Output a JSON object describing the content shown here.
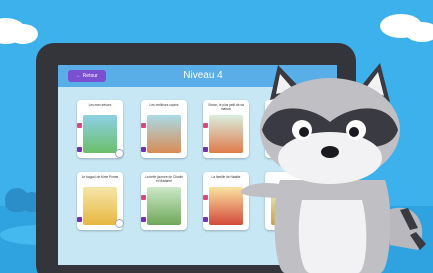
{
  "header": {
    "back_label": "← Retour",
    "title": "Niveau 4"
  },
  "books": [
    {
      "title": "Les mes trésors"
    },
    {
      "title": "Les meilleurs copins"
    },
    {
      "title": "Simon, le plus petit de sa maison"
    },
    {
      "title": ""
    },
    {
      "title": "Le bagoul de Mme Pomte"
    },
    {
      "title": "La belle journée de Charlie et Madame"
    },
    {
      "title": "La famille de Natalie"
    },
    {
      "title": ""
    }
  ],
  "colors": {
    "sky": "#3cb1ec",
    "tablet": "#34343b",
    "accent": "#7a4fd0",
    "header": "#5aaee8"
  }
}
